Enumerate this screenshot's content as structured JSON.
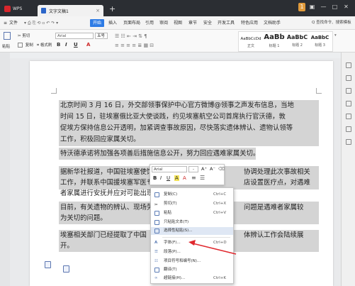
{
  "titlebar": {
    "app_tab": "WPS",
    "doc_tab": "文字文稿1",
    "close_glyph": "×",
    "new_tab_glyph": "+",
    "window_badge": "1"
  },
  "menubar": {
    "file": "文件",
    "items": [
      "开始",
      "插入",
      "页面布局",
      "引用",
      "审阅",
      "视图",
      "章节",
      "安全",
      "开发工具",
      "特色应用",
      "文档助手"
    ],
    "search": "Q 查找命令、搜索模板"
  },
  "toolbar": {
    "cut": "剪切",
    "copy": "复制",
    "format_painter": "格式刷",
    "paste": "粘贴",
    "font_name": "Arial",
    "font_size": "五号",
    "bold": "B",
    "italic": "I",
    "underline": "U",
    "font_color": "A",
    "styles": [
      {
        "sample": "AaBbCcDd",
        "label": "正文"
      },
      {
        "sample": "AaBb",
        "label": "标题 1"
      },
      {
        "sample": "AaBbC",
        "label": "标题 2"
      },
      {
        "sample": "AaBbC",
        "label": "标题 3"
      }
    ]
  },
  "document": {
    "line1": "北京时间 3 月 16 日，外交部领事保护中心官方微博@领事之声发布信息，当地",
    "line2": "时间 15 日，驻埃塞俄比亚大使谈践，约见埃塞航空公司首席执行官沃德，敦",
    "line3": "促埃方保持信息公开透明，加紧调查事故原因，尽快落实遗体辨认、遗物认领等",
    "line4": "工作，积极回应家属关切。",
    "line5": "特沃德承诺将加强各项善后措施信息公开，努力回应遇难家属关切。",
    "line6a": "据新华社报道，中国驻埃塞使馆",
    "line6b": "协调处理此次事故相关",
    "line7a": "工作，并联系中国援埃塞军医专",
    "line7b": "店设置医疗点，对遇难",
    "line8": "者家属进行安抚并应对可能出现",
    "line9a": "目前，有关遗物的辨认、现场劳",
    "line9b": "问题是遇难者家属较",
    "line10": "为关切的问题。",
    "line11a": "埃塞相关部门已经提取了中国",
    "line11b": "体辨认工作会陆续展",
    "line12": "开。"
  },
  "mini_toolbar": {
    "font": "Arial",
    "size": "-",
    "grow": "A⁺",
    "shrink": "A⁻",
    "bold": "B",
    "italic": "I",
    "underline": "U",
    "strike": "A",
    "font_color": "A",
    "align": "≡"
  },
  "context_menu": {
    "items": [
      {
        "label": "复制(C)",
        "key": "Ctrl+C"
      },
      {
        "label": "剪切(T)",
        "key": "Ctrl+X"
      },
      {
        "label": "粘贴",
        "key": "Ctrl+V"
      },
      {
        "label": "只粘贴文本(T)",
        "key": ""
      },
      {
        "label": "选择性粘贴(S)...",
        "key": ""
      },
      {
        "label": "字体(F)...",
        "key": "Ctrl+D"
      },
      {
        "label": "段落(P)...",
        "key": ""
      },
      {
        "label": "项目符号和编号(N)...",
        "key": ""
      },
      {
        "label": "翻译(T)",
        "key": ""
      },
      {
        "label": "超链接(H)...",
        "key": "Ctrl+K"
      }
    ]
  },
  "colors": {
    "titlebar_bg": "#2b2e33",
    "accent": "#2d7be5",
    "selection": "#d4d4d4",
    "arrow": "#e0282e"
  }
}
